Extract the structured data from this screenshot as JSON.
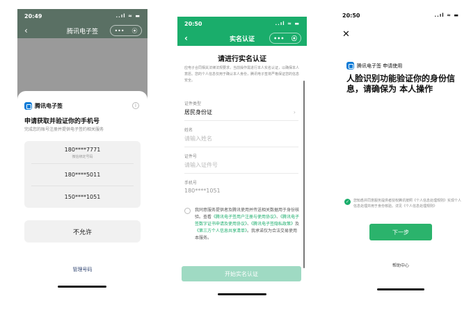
{
  "colors": {
    "brand_green": "#1aad6b",
    "button_green": "#2bb36c",
    "dim_header": "#5a7064",
    "disabled_button": "#9fdac3",
    "brand_blue": "#0a7bd7"
  },
  "screen1": {
    "status_time": "20:49",
    "status_icons": "..ıl ≈ ▬",
    "nav_title": "腾讯电子签",
    "capsule_dots": "•••",
    "capsule_close": "⦿",
    "brand": "腾讯电子签",
    "heading": "申请获取并验证你的手机号",
    "description": "完成您的账号注册并提供电子签约相关服务",
    "phones": [
      {
        "number": "180****7771",
        "note": "微信绑定号码"
      },
      {
        "number": "180****5011"
      },
      {
        "number": "150****1051"
      }
    ],
    "deny_label": "不允许",
    "manage_label": "管理号码"
  },
  "screen2": {
    "status_time": "20:50",
    "status_icons": "..ıl ≈ ▬",
    "nav_title": "实名认证",
    "capsule_dots": "•••",
    "capsule_close": "⦿",
    "title": "请进行实名认证",
    "intro": "应电子合同相关法律法规要求，当前操作需进行本人实名认证，以确保本人意愿。您的个人信息仅用于确认本人身份，腾讯电子签将严格保证您的信息安全。",
    "id_type_label": "证件类型",
    "id_type_value": "居民身份证",
    "name_label": "姓名",
    "name_placeholder": "请输入姓名",
    "id_label": "证件号",
    "id_placeholder": "请输入证件号",
    "mobile_label": "手机号",
    "mobile_value": "180****1051",
    "agreement_prefix": "我同意服务提供者及腾讯使用并传送相关数据用于身份核验。查看",
    "link1": "《腾讯电子签用户注册与使用协议》",
    "sep1": "、",
    "link2": "《腾讯电子签数字证书申请及使用协议》",
    "sep2": "、",
    "link3": "《腾讯电子签隐私政策》",
    "sep3": "及",
    "link4": "《第三方个人信息共享清单》",
    "agreement_suffix": "。我承诺仅为合法交易使用本服务。",
    "start_button": "开始实名认证"
  },
  "screen3": {
    "status_time": "20:50",
    "status_icons": "..ıl ≈ ▬",
    "close_icon_glyph": "✕",
    "brand_line": "腾讯电子签 申请使用",
    "title": "人脸识别功能验证你的身份信息，请确保为 本人操作",
    "consent_text": "您知悉并同意服务提供者授权腾讯按照《个人信息处理规则》实现个人信息处理并用于身份核验。详见《个人信息处理规则》",
    "next_button": "下一步",
    "help_label": "帮助中心"
  }
}
